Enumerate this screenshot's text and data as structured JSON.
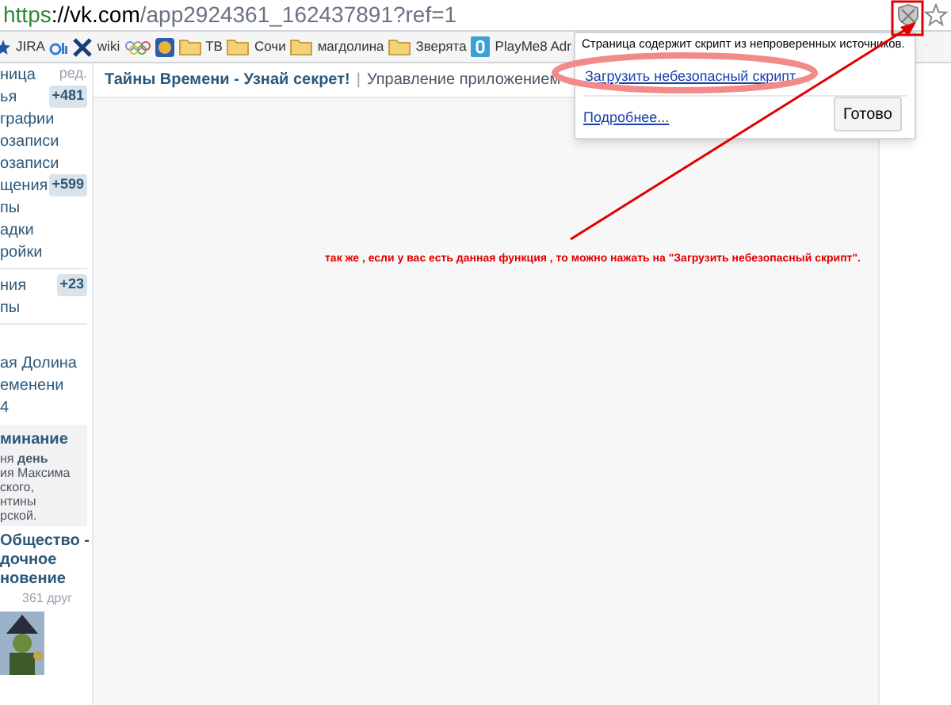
{
  "address_bar": {
    "scheme": "https",
    "host": "://vk.com",
    "path": "/app2924361_162437891?ref=1"
  },
  "bookmarks": [
    {
      "kind": "star"
    },
    {
      "kind": "text",
      "label": "JIRA"
    },
    {
      "kind": "ai"
    },
    {
      "kind": "x",
      "label": "wiki"
    },
    {
      "kind": "rings"
    },
    {
      "kind": "badge"
    },
    {
      "kind": "folder",
      "label": "ТВ"
    },
    {
      "kind": "folder",
      "label": "Сочи"
    },
    {
      "kind": "folder",
      "label": "магдолина"
    },
    {
      "kind": "folder",
      "label": "Зверята"
    },
    {
      "kind": "app",
      "label": "PlayMe8 Adr"
    }
  ],
  "sidebar": {
    "edit_label": "ред.",
    "items": [
      {
        "label": "ница"
      },
      {
        "label": "ья",
        "count": "+481"
      },
      {
        "label": "графии"
      },
      {
        "label": "озаписи"
      },
      {
        "label": "озаписи"
      },
      {
        "label": "щения",
        "count": "+599"
      },
      {
        "label": "пы"
      },
      {
        "label": "адки"
      },
      {
        "label": "ройки"
      },
      {
        "label": "ния",
        "count": "+23",
        "divider_before": true
      },
      {
        "label": "пы"
      }
    ],
    "links": [
      "ая Долина",
      "еменени",
      "4"
    ],
    "reminder": {
      "title": "минание",
      "text": "ня **день**\nия Максима\nского,\nнтины\nрской."
    },
    "group": {
      "title": "Общество -\nдочное\nновение",
      "friends": "361 друг"
    }
  },
  "app_header": {
    "title": "Тайны Времени - Узнай секрет!",
    "separator": "|",
    "link": "Управление приложением"
  },
  "popup": {
    "message": "Страница содержит скрипт из непроверенных источников.",
    "load_link": "Загрузить небезопасный скрипт",
    "more_link": "Подробнее...",
    "done_button": "Готово"
  },
  "annotation": {
    "text": "так же , если у вас есть данная функция , то можно нажать на \"Загрузить небезопасный скрипт\"."
  }
}
